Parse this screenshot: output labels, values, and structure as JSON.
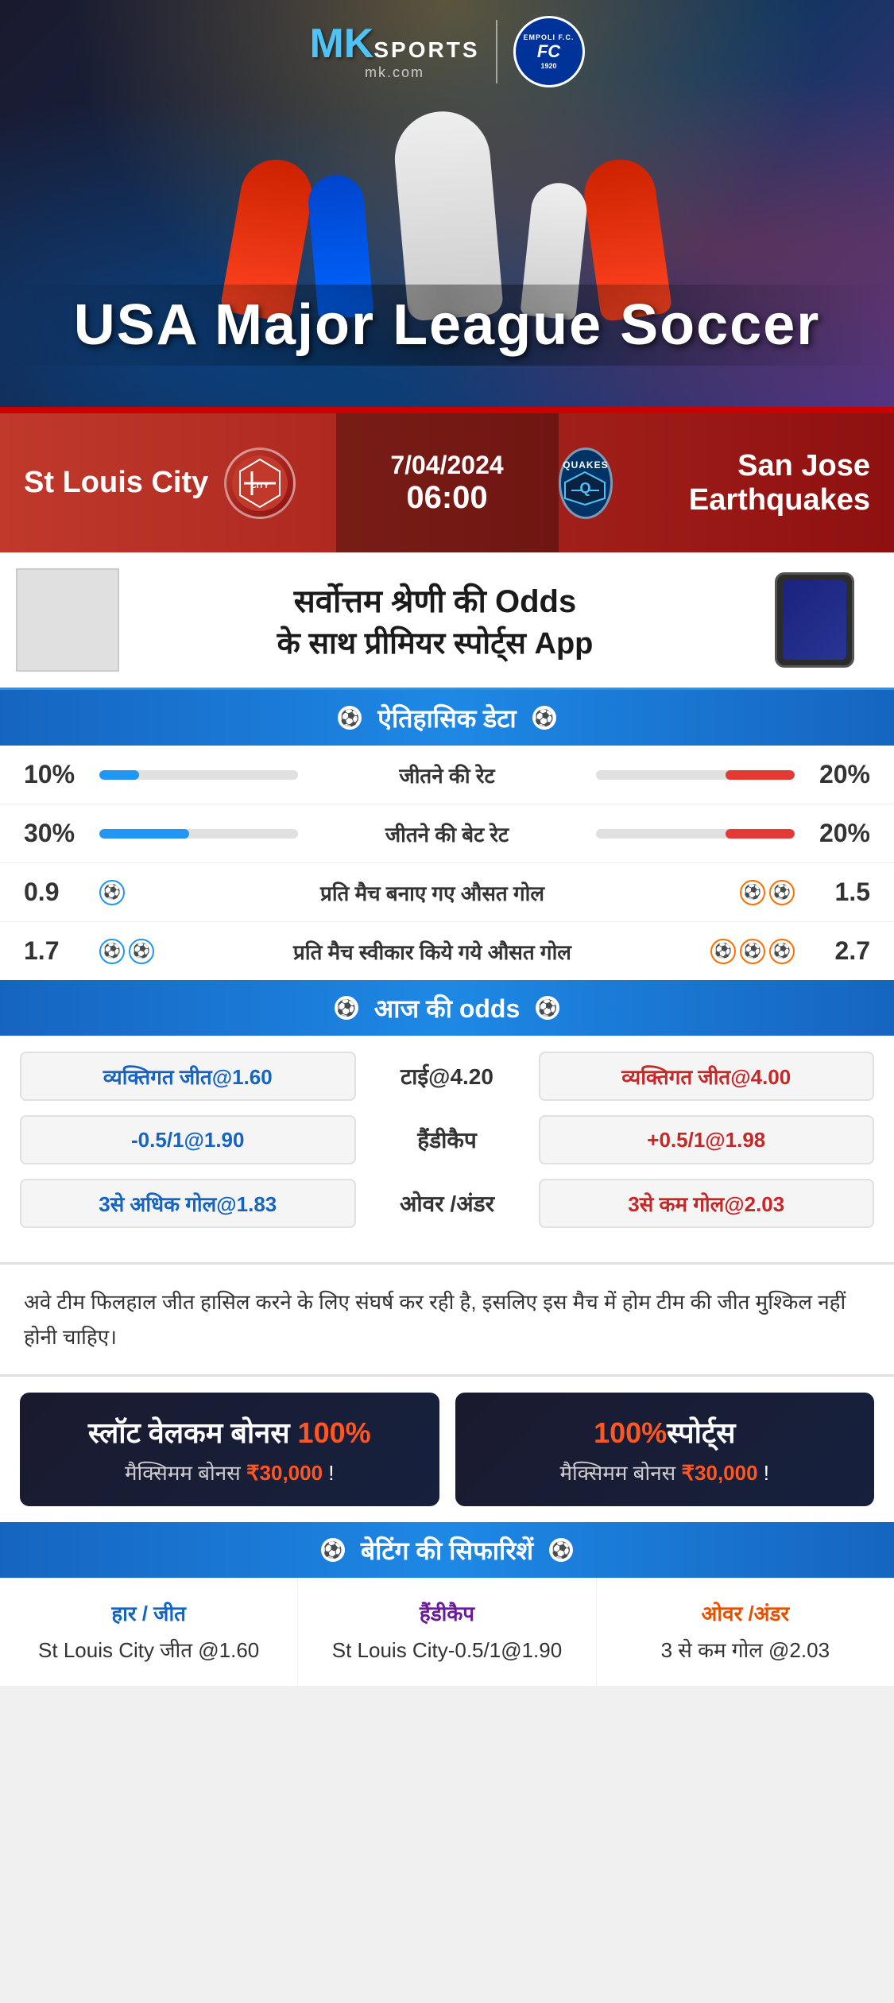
{
  "brand": {
    "mk": "MK",
    "sports": "SPORTS",
    "mk_com": "mk.com",
    "empoli_top": "EMPOLI F.C.",
    "empoli_year": "1920"
  },
  "hero": {
    "title": "USA Major League Soccer",
    "red_bar_label": ""
  },
  "match": {
    "team_left": "St Louis City",
    "team_right": "San Jose Earthquakes",
    "quakes_label": "QUAKES",
    "date": "7/04/2024",
    "time": "06:00"
  },
  "ad": {
    "title": "सर्वोत्तम श्रेणी की Odds",
    "subtitle": "के साथ प्रीमियर स्पोर्ट्स App"
  },
  "historical": {
    "section_title": "ऐतिहासिक डेटा",
    "stats": [
      {
        "label": "जीतने की रेट",
        "left_value": "10%",
        "right_value": "20%",
        "left_pct": 20,
        "right_pct": 35
      },
      {
        "label": "जीतने की बेट रेट",
        "left_value": "30%",
        "right_value": "20%",
        "left_pct": 45,
        "right_pct": 35
      },
      {
        "label": "प्रति मैच बनाए गए औसत गोल",
        "left_value": "0.9",
        "right_value": "1.5",
        "left_balls": 1,
        "right_balls": 2
      },
      {
        "label": "प्रति मैच स्वीकार किये गये औसत गोल",
        "left_value": "1.7",
        "right_value": "2.7",
        "left_balls": 2,
        "right_balls": 3
      }
    ]
  },
  "odds": {
    "section_title": "आज की odds",
    "rows": [
      {
        "left_label": "व्यक्तिगत जीत@1.60",
        "center_label": "टाई@4.20",
        "right_label": "व्यक्तिगत जीत@4.00",
        "left_color": "blue",
        "right_color": "red"
      },
      {
        "left_label": "-0.5/1@1.90",
        "center_label": "हैंडीकैप",
        "right_label": "+0.5/1@1.98",
        "left_color": "blue",
        "right_color": "red"
      },
      {
        "left_label": "3से अधिक गोल@1.83",
        "center_label": "ओवर /अंडर",
        "right_label": "3से कम गोल@2.03",
        "left_color": "blue",
        "right_color": "red"
      }
    ]
  },
  "analysis": {
    "text": "अवे टीम फिलहाल जीत हासिल करने के लिए संघर्ष कर रही है, इसलिए इस मैच में होम टीम की जीत मुश्किल नहीं होनी चाहिए।"
  },
  "bonus": {
    "card1_title": "स्लॉट वेलकम बोनस 100%",
    "card1_subtitle": "मैक्सिमम बोनस ₹30,000  !",
    "card2_title": "100%स्पोर्ट्स",
    "card2_subtitle": "मैक्सिमम बोनस  ₹30,000 !"
  },
  "recommendations": {
    "section_title": "बेटिंग की सिफारिशें",
    "items": [
      {
        "type": "हार / जीत",
        "type_color": "blue",
        "value": "St Louis City जीत @1.60"
      },
      {
        "type": "हैंडीकैप",
        "type_color": "purple",
        "value": "St Louis City-0.5/1@1.90"
      },
      {
        "type": "ओवर /अंडर",
        "type_color": "orange",
        "value": "3 से कम गोल @2.03"
      }
    ]
  }
}
